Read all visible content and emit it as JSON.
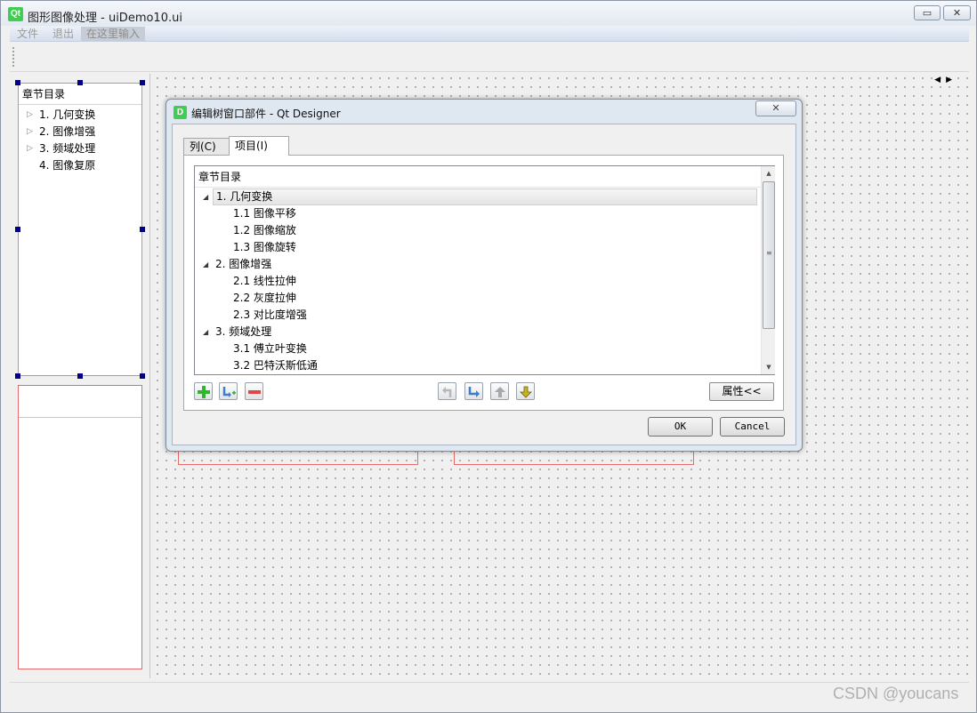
{
  "window": {
    "title": "图形图像处理 - uiDemo10.ui",
    "logo_text": "Qt",
    "minimize_glyph": "▭",
    "close_glyph": "✕"
  },
  "menu": {
    "items": [
      "文件",
      "退出",
      "在这里输入"
    ]
  },
  "left_tree": {
    "header": "章节目录",
    "items": [
      {
        "label": "1. 几何变换",
        "expandable": true
      },
      {
        "label": "2. 图像增强",
        "expandable": true
      },
      {
        "label": "3. 频域处理",
        "expandable": true
      },
      {
        "label": "4. 图像复原",
        "expandable": false
      }
    ]
  },
  "dialog": {
    "title": "编辑树窗口部件 - Qt Designer",
    "icon_text": "D",
    "close_glyph": "✕",
    "tabs": [
      {
        "label": "列(C)",
        "active": false
      },
      {
        "label": "项目(I)",
        "active": true
      }
    ],
    "tree": {
      "header": "章节目录",
      "rows": [
        {
          "label": "1. 几何变换",
          "level": 0,
          "expanded": true,
          "selected": true
        },
        {
          "label": "1.1 图像平移",
          "level": 1
        },
        {
          "label": "1.2 图像缩放",
          "level": 1
        },
        {
          "label": "1.3 图像旋转",
          "level": 1
        },
        {
          "label": "2. 图像增强",
          "level": 0,
          "expanded": true
        },
        {
          "label": "2.1 线性拉伸",
          "level": 1
        },
        {
          "label": "2.2 灰度拉伸",
          "level": 1
        },
        {
          "label": "2.3 对比度增强",
          "level": 1
        },
        {
          "label": "3. 频域处理",
          "level": 0,
          "expanded": true
        },
        {
          "label": "3.1 傅立叶变换",
          "level": 1
        },
        {
          "label": "3.2 巴特沃斯低通",
          "level": 1
        }
      ]
    },
    "properties_label": "属性<<",
    "ok_label": "OK",
    "cancel_label": "Cancel"
  },
  "watermark": "CSDN @youcans",
  "colors": {
    "qt_green": "#41cd52",
    "selection_handle": "#000080",
    "layout_red": "#e46b6b"
  }
}
